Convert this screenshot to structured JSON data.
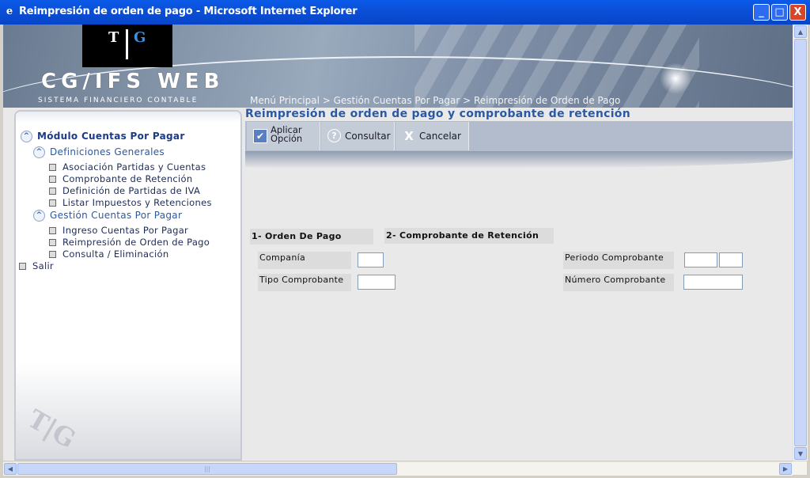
{
  "window": {
    "title": "Reimpresión de orden de pago - Microsoft Internet Explorer",
    "minimize": "_",
    "maximize": "□",
    "close": "X"
  },
  "header": {
    "brand": "CG/IFS WEB",
    "subtitle": "SISTEMA FINANCIERO CONTABLE",
    "logo_left": "T",
    "logo_right": "G",
    "breadcrumb": "Menú Principal > Gestión Cuentas Por Pagar > Reimpresión de Orden de Pago"
  },
  "sidebar": {
    "module": "Módulo Cuentas Por Pagar",
    "sections": [
      {
        "label": "Definiciones Generales",
        "items": [
          "Asociación Partidas y Cuentas",
          "Comprobante de Retención",
          "Definición de Partidas de IVA",
          "Listar Impuestos y Retenciones"
        ]
      },
      {
        "label": "Gestión Cuentas Por Pagar",
        "items": [
          "Ingreso Cuentas Por Pagar",
          "Reimpresión de Orden de Pago",
          "Consulta / Eliminación"
        ]
      }
    ],
    "exit": "Salir"
  },
  "page": {
    "title": "Reimpresión de orden de pago y comprobante de retención"
  },
  "toolbar": {
    "apply_label": "Aplicar Opción",
    "consult_label": "Consultar",
    "cancel_label": "Cancelar"
  },
  "form": {
    "tab1": "1- Orden De Pago",
    "tab2": "2- Comprobante de Retención",
    "compania_label": "Companía",
    "tipo_label": "Tipo Comprobante",
    "periodo_label": "Periodo Comprobante",
    "numero_label": "Número Comprobante",
    "compania_value": "",
    "tipo_value": "",
    "periodo_value_1": "",
    "periodo_value_2": "",
    "numero_value": ""
  },
  "icons": {
    "apply": "checkbox-icon",
    "consult": "question-icon",
    "cancel": "x-icon"
  },
  "colors": {
    "titlebar": "#0a5ae8",
    "accent": "#2a5aa6",
    "toolbar": "#b2bccc"
  }
}
